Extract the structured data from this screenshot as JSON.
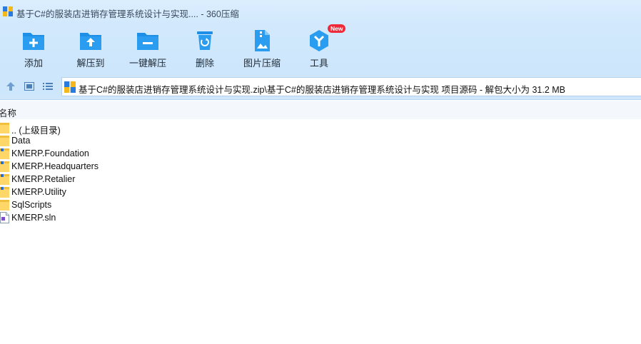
{
  "window": {
    "title": "基于C#的服装店进销存管理系统设计与实现.... - 360压缩"
  },
  "toolbar": {
    "items": [
      {
        "label": "添加",
        "icon": "add-icon"
      },
      {
        "label": "解压到",
        "icon": "extract-to-icon"
      },
      {
        "label": "一键解压",
        "icon": "one-click-extract-icon"
      },
      {
        "label": "删除",
        "icon": "delete-icon"
      },
      {
        "label": "图片压缩",
        "icon": "image-compress-icon"
      },
      {
        "label": "工具",
        "icon": "tools-icon",
        "badge": "New"
      }
    ]
  },
  "address": {
    "path": "基于C#的服装店进销存管理系统设计与实现.zip\\基于C#的服装店进销存管理系统设计与实现 项目源码 - 解包大小为 31.2 MB"
  },
  "list": {
    "column_name": "名称",
    "rows": [
      {
        "name": ".. (上级目录)",
        "type": "parent"
      },
      {
        "name": "Data",
        "type": "folder"
      },
      {
        "name": "KMERP.Foundation",
        "type": "folder"
      },
      {
        "name": "KMERP.Headquarters",
        "type": "folder"
      },
      {
        "name": "KMERP.Retalier",
        "type": "folder"
      },
      {
        "name": "KMERP.Utility",
        "type": "folder"
      },
      {
        "name": "SqlScripts",
        "type": "folder"
      },
      {
        "name": "KMERP.sln",
        "type": "file"
      }
    ]
  },
  "colors": {
    "accent": "#1e8fe6",
    "titlebar": "#d7ecfe",
    "badge": "#ef2b3a"
  }
}
